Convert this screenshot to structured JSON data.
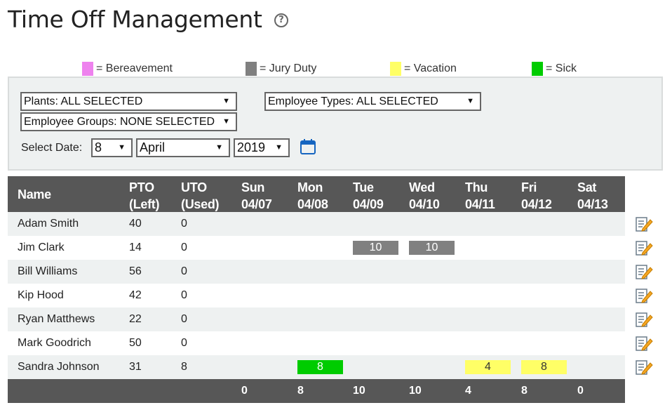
{
  "page": {
    "title": "Time Off Management"
  },
  "legend": [
    {
      "label": "= Bereavement",
      "color": "#ee82ee"
    },
    {
      "label": "= Jury Duty",
      "color": "#808080"
    },
    {
      "label": "= Vacation",
      "color": "#ffff66"
    },
    {
      "label": "= Sick",
      "color": "#00cc00"
    }
  ],
  "filters": {
    "plants": "Plants: ALL SELECTED",
    "employee_types": "Employee Types: ALL SELECTED",
    "employee_groups": "Employee Groups: NONE SELECTED",
    "select_date_label": "Select Date:",
    "day": "8",
    "month": "April",
    "year": "2019"
  },
  "table": {
    "headers": {
      "name": "Name",
      "pto_1": "PTO",
      "pto_2": "(Left)",
      "uto_1": "UTO",
      "uto_2": "(Used)",
      "days": [
        {
          "day": "Sun",
          "date": "04/07"
        },
        {
          "day": "Mon",
          "date": "04/08"
        },
        {
          "day": "Tue",
          "date": "04/09"
        },
        {
          "day": "Wed",
          "date": "04/10"
        },
        {
          "day": "Thu",
          "date": "04/11"
        },
        {
          "day": "Fri",
          "date": "04/12"
        },
        {
          "day": "Sat",
          "date": "04/13"
        }
      ]
    },
    "rows": [
      {
        "name": "Adam Smith",
        "pto": "40",
        "uto": "0",
        "entries": []
      },
      {
        "name": "Jim Clark",
        "pto": "14",
        "uto": "0",
        "entries": [
          {
            "day": 2,
            "hours": "10",
            "type": "jury"
          },
          {
            "day": 3,
            "hours": "10",
            "type": "jury"
          }
        ]
      },
      {
        "name": "Bill Williams",
        "pto": "56",
        "uto": "0",
        "entries": []
      },
      {
        "name": "Kip Hood",
        "pto": "42",
        "uto": "0",
        "entries": []
      },
      {
        "name": "Ryan Matthews",
        "pto": "22",
        "uto": "0",
        "entries": []
      },
      {
        "name": "Mark Goodrich",
        "pto": "50",
        "uto": "0",
        "entries": []
      },
      {
        "name": "Sandra Johnson",
        "pto": "31",
        "uto": "8",
        "entries": [
          {
            "day": 1,
            "hours": "8",
            "type": "sick"
          },
          {
            "day": 4,
            "hours": "4",
            "type": "vacation"
          },
          {
            "day": 5,
            "hours": "8",
            "type": "vacation"
          }
        ]
      }
    ],
    "totals": [
      "0",
      "8",
      "10",
      "10",
      "4",
      "8",
      "0"
    ]
  },
  "type_colors": {
    "bereavement": "#ee82ee",
    "jury": "#808080",
    "vacation": "#ffff66",
    "sick": "#00cc00"
  }
}
